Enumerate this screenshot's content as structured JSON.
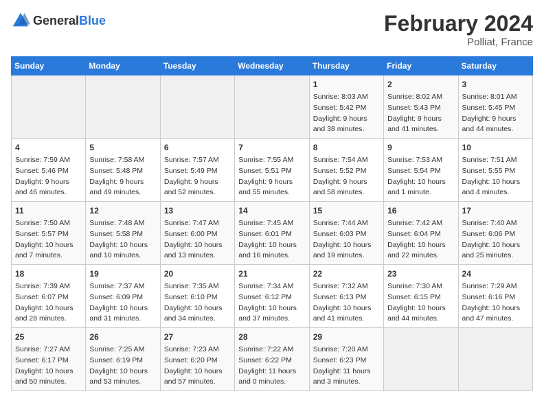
{
  "header": {
    "logo_general": "General",
    "logo_blue": "Blue",
    "month_year": "February 2024",
    "location": "Polliat, France"
  },
  "calendar": {
    "days_of_week": [
      "Sunday",
      "Monday",
      "Tuesday",
      "Wednesday",
      "Thursday",
      "Friday",
      "Saturday"
    ],
    "weeks": [
      [
        {
          "day": "",
          "content": ""
        },
        {
          "day": "",
          "content": ""
        },
        {
          "day": "",
          "content": ""
        },
        {
          "day": "",
          "content": ""
        },
        {
          "day": "1",
          "content": "Sunrise: 8:03 AM\nSunset: 5:42 PM\nDaylight: 9 hours\nand 38 minutes."
        },
        {
          "day": "2",
          "content": "Sunrise: 8:02 AM\nSunset: 5:43 PM\nDaylight: 9 hours\nand 41 minutes."
        },
        {
          "day": "3",
          "content": "Sunrise: 8:01 AM\nSunset: 5:45 PM\nDaylight: 9 hours\nand 44 minutes."
        }
      ],
      [
        {
          "day": "4",
          "content": "Sunrise: 7:59 AM\nSunset: 5:46 PM\nDaylight: 9 hours\nand 46 minutes."
        },
        {
          "day": "5",
          "content": "Sunrise: 7:58 AM\nSunset: 5:48 PM\nDaylight: 9 hours\nand 49 minutes."
        },
        {
          "day": "6",
          "content": "Sunrise: 7:57 AM\nSunset: 5:49 PM\nDaylight: 9 hours\nand 52 minutes."
        },
        {
          "day": "7",
          "content": "Sunrise: 7:55 AM\nSunset: 5:51 PM\nDaylight: 9 hours\nand 55 minutes."
        },
        {
          "day": "8",
          "content": "Sunrise: 7:54 AM\nSunset: 5:52 PM\nDaylight: 9 hours\nand 58 minutes."
        },
        {
          "day": "9",
          "content": "Sunrise: 7:53 AM\nSunset: 5:54 PM\nDaylight: 10 hours\nand 1 minute."
        },
        {
          "day": "10",
          "content": "Sunrise: 7:51 AM\nSunset: 5:55 PM\nDaylight: 10 hours\nand 4 minutes."
        }
      ],
      [
        {
          "day": "11",
          "content": "Sunrise: 7:50 AM\nSunset: 5:57 PM\nDaylight: 10 hours\nand 7 minutes."
        },
        {
          "day": "12",
          "content": "Sunrise: 7:48 AM\nSunset: 5:58 PM\nDaylight: 10 hours\nand 10 minutes."
        },
        {
          "day": "13",
          "content": "Sunrise: 7:47 AM\nSunset: 6:00 PM\nDaylight: 10 hours\nand 13 minutes."
        },
        {
          "day": "14",
          "content": "Sunrise: 7:45 AM\nSunset: 6:01 PM\nDaylight: 10 hours\nand 16 minutes."
        },
        {
          "day": "15",
          "content": "Sunrise: 7:44 AM\nSunset: 6:03 PM\nDaylight: 10 hours\nand 19 minutes."
        },
        {
          "day": "16",
          "content": "Sunrise: 7:42 AM\nSunset: 6:04 PM\nDaylight: 10 hours\nand 22 minutes."
        },
        {
          "day": "17",
          "content": "Sunrise: 7:40 AM\nSunset: 6:06 PM\nDaylight: 10 hours\nand 25 minutes."
        }
      ],
      [
        {
          "day": "18",
          "content": "Sunrise: 7:39 AM\nSunset: 6:07 PM\nDaylight: 10 hours\nand 28 minutes."
        },
        {
          "day": "19",
          "content": "Sunrise: 7:37 AM\nSunset: 6:09 PM\nDaylight: 10 hours\nand 31 minutes."
        },
        {
          "day": "20",
          "content": "Sunrise: 7:35 AM\nSunset: 6:10 PM\nDaylight: 10 hours\nand 34 minutes."
        },
        {
          "day": "21",
          "content": "Sunrise: 7:34 AM\nSunset: 6:12 PM\nDaylight: 10 hours\nand 37 minutes."
        },
        {
          "day": "22",
          "content": "Sunrise: 7:32 AM\nSunset: 6:13 PM\nDaylight: 10 hours\nand 41 minutes."
        },
        {
          "day": "23",
          "content": "Sunrise: 7:30 AM\nSunset: 6:15 PM\nDaylight: 10 hours\nand 44 minutes."
        },
        {
          "day": "24",
          "content": "Sunrise: 7:29 AM\nSunset: 6:16 PM\nDaylight: 10 hours\nand 47 minutes."
        }
      ],
      [
        {
          "day": "25",
          "content": "Sunrise: 7:27 AM\nSunset: 6:17 PM\nDaylight: 10 hours\nand 50 minutes."
        },
        {
          "day": "26",
          "content": "Sunrise: 7:25 AM\nSunset: 6:19 PM\nDaylight: 10 hours\nand 53 minutes."
        },
        {
          "day": "27",
          "content": "Sunrise: 7:23 AM\nSunset: 6:20 PM\nDaylight: 10 hours\nand 57 minutes."
        },
        {
          "day": "28",
          "content": "Sunrise: 7:22 AM\nSunset: 6:22 PM\nDaylight: 11 hours\nand 0 minutes."
        },
        {
          "day": "29",
          "content": "Sunrise: 7:20 AM\nSunset: 6:23 PM\nDaylight: 11 hours\nand 3 minutes."
        },
        {
          "day": "",
          "content": ""
        },
        {
          "day": "",
          "content": ""
        }
      ]
    ]
  }
}
